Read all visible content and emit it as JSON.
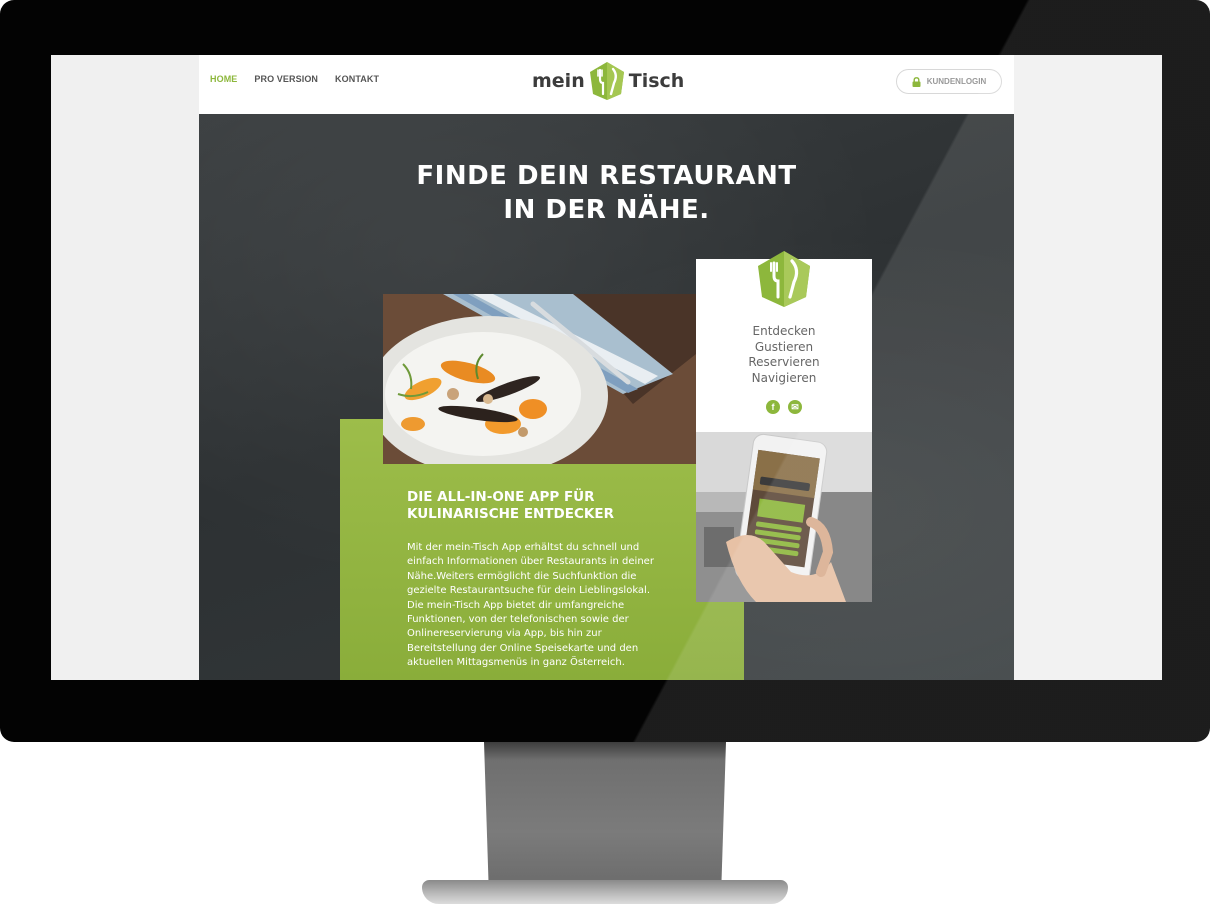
{
  "nav": {
    "items": [
      {
        "label": "HOME",
        "active": true
      },
      {
        "label": "PRO VERSION",
        "active": false
      },
      {
        "label": "KONTAKT",
        "active": false
      }
    ]
  },
  "logo": {
    "part1": "mein",
    "part2": "Tisch"
  },
  "login": {
    "label": "KUNDENLOGIN",
    "icon": "lock-icon"
  },
  "hero": {
    "title_line1": "FINDE DEIN RESTAURANT",
    "title_line2": "IN DER NÄHE."
  },
  "info_card": {
    "taglines": [
      "Entdecken",
      "Gustieren",
      "Reservieren",
      "Navigieren"
    ],
    "social": [
      {
        "icon": "facebook-icon",
        "glyph": "f"
      },
      {
        "icon": "mail-icon",
        "glyph": "✉"
      }
    ]
  },
  "feature": {
    "heading_line1": "DIE ALL-IN-ONE APP FÜR",
    "heading_line2": "KULINARISCHE ENTDECKER",
    "body": "Mit der mein-Tisch App erhältst du schnell und einfach Informationen über Restaurants in deiner Nähe.Weiters ermöglicht die Suchfunktion die gezielte Restaurantsuche für dein Lieblingslokal. Die mein-Tisch App bietet dir umfangreiche Funktionen, von der telefonischen sowie der Onlinereservierung via App, bis hin zur Bereitstellung der Online Speisekarte und den aktuellen Mittagsmenüs in ganz Österreich."
  },
  "colors": {
    "accent": "#8db73c",
    "chalkboard": "#33383a",
    "frame": "#030303"
  }
}
